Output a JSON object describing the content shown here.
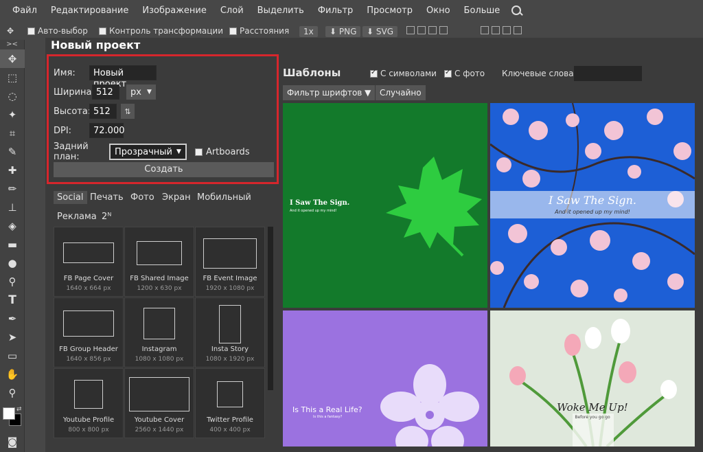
{
  "menu": [
    "Файл",
    "Редактирование",
    "Изображение",
    "Слой",
    "Выделить",
    "Фильтр",
    "Просмотр",
    "Окно",
    "Больше"
  ],
  "options": {
    "auto_select": "Авто-выбор",
    "transform_controls": "Контроль трансформации",
    "distances": "Расстояния",
    "zoom": "1x",
    "png": "PNG",
    "svg": "SVG"
  },
  "toolbar_collapse": "><",
  "dialog": {
    "title": "Новый проект",
    "name_label": "Имя:",
    "name_value": "Новый проект",
    "width_label": "Ширина:",
    "width_value": "512",
    "unit": "px",
    "height_label": "Высота:",
    "height_value": "512",
    "dpi_label": "DPI:",
    "dpi_value": "72.000",
    "background_label": "Задний план:",
    "background_value": "Прозрачный",
    "artboards_label": "Artboards",
    "create_label": "Создать"
  },
  "categories": [
    "Social",
    "Печать",
    "Фото",
    "Экран",
    "Мобильный",
    "Реклама",
    "2ᴺ"
  ],
  "presets": [
    {
      "name": "FB Page Cover",
      "size": "1640 x 664 px"
    },
    {
      "name": "FB Shared Image",
      "size": "1200 x 630 px"
    },
    {
      "name": "FB Event Image",
      "size": "1920 x 1080 px"
    },
    {
      "name": "FB Group Header",
      "size": "1640 x 856 px"
    },
    {
      "name": "Instagram",
      "size": "1080 x 1080 px"
    },
    {
      "name": "Insta Story",
      "size": "1080 x 1920 px"
    },
    {
      "name": "Youtube Profile",
      "size": "800 x 800 px"
    },
    {
      "name": "Youtube Cover",
      "size": "2560 x 1440 px"
    },
    {
      "name": "Twitter Profile",
      "size": "400 x 400 px"
    }
  ],
  "templates": {
    "title": "Шаблоны",
    "with_symbols": "С символами",
    "with_photo": "С фото",
    "keywords_label": "Ключевые слова:",
    "font_filter": "Фильтр шрифтов ▼",
    "random": "Случайно",
    "tiles": [
      {
        "title": "I Saw The Sign.",
        "subtitle": "And it opened up my mind!"
      },
      {
        "title": "I Saw The Sign.",
        "subtitle": "And it opened up my mind!"
      },
      {
        "title": "Is This a Real Life?",
        "subtitle": "Is this a fantasy?"
      },
      {
        "title": "Woke Me Up!",
        "subtitle": "Before you go go"
      }
    ]
  },
  "colors": {
    "accent_red": "#d6262c",
    "green_tile": "#137a2b",
    "leaf": "#2ecc40",
    "sky": "#1d5fd6",
    "purple_tile": "#9b72e0"
  }
}
